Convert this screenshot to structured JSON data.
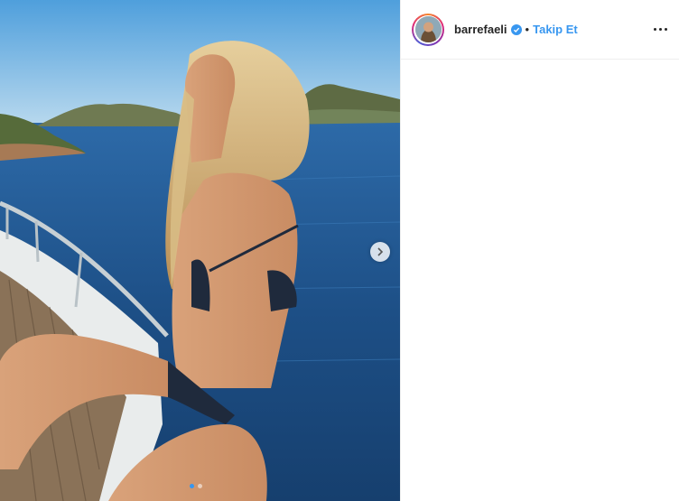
{
  "post": {
    "author": {
      "username": "barrefaeli",
      "verified": true,
      "avatar_icon": "profile-photo"
    },
    "separator": "•",
    "follow_label": "Takip Et",
    "more_icon": "more-horizontal-icon",
    "media": {
      "description_icon": "photo-woman-on-boat-deck",
      "next_icon": "chevron-right-icon",
      "carousel_count": 2,
      "carousel_active": 1
    }
  },
  "colors": {
    "link": "#3897f0",
    "text": "#262626",
    "border": "#efefef",
    "verified": "#3897f0"
  }
}
